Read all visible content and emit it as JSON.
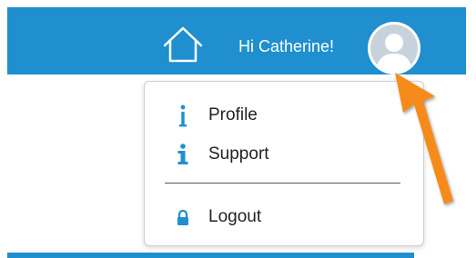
{
  "header": {
    "greeting": "Hi Catherine!",
    "home_icon": "home-icon",
    "avatar_icon": "user-avatar-icon"
  },
  "user_menu": {
    "items": [
      {
        "label": "Profile",
        "icon": "info-icon"
      },
      {
        "label": "Support",
        "icon": "info-icon"
      },
      {
        "label": "Logout",
        "icon": "lock-icon"
      }
    ]
  },
  "colors": {
    "header_bg": "#1f8fd0",
    "menu_icon": "#1f8fd0",
    "annotation_arrow": "#f68b1f"
  }
}
